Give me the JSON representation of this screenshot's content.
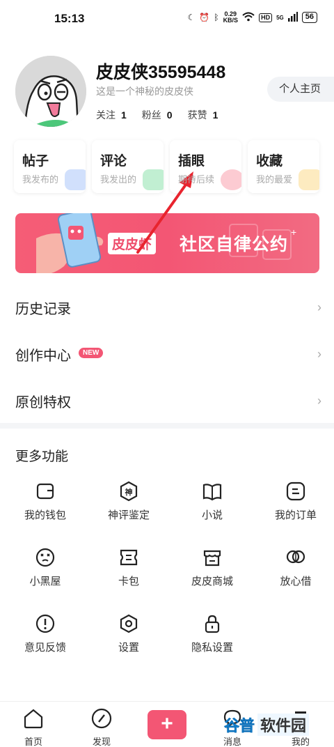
{
  "status": {
    "time": "15:13",
    "speed_value": "0.29",
    "speed_unit": "KB/S",
    "hd": "HD",
    "signal": "5G",
    "battery": "56"
  },
  "profile": {
    "username": "皮皮侠35595448",
    "bio": "这是一个神秘的皮皮侠",
    "stats": [
      {
        "label": "关注",
        "value": "1"
      },
      {
        "label": "粉丝",
        "value": "0"
      },
      {
        "label": "获赞",
        "value": "1"
      }
    ],
    "home_button": "个人主页"
  },
  "cards": [
    {
      "title": "帖子",
      "subtitle": "我发布的",
      "color": "#7aa6f5"
    },
    {
      "title": "评论",
      "subtitle": "我发出的",
      "color": "#4cd07d"
    },
    {
      "title": "插眼",
      "subtitle": "期待后续",
      "color": "#f56a7e"
    },
    {
      "title": "收藏",
      "subtitle": "我的最爱",
      "color": "#f8c54b"
    }
  ],
  "banner": {
    "logo": "皮皮虾",
    "text": "社区自律公约"
  },
  "menu": [
    {
      "label": "历史记录"
    },
    {
      "label": "创作中心",
      "badge": "NEW"
    },
    {
      "label": "原创特权"
    }
  ],
  "more": {
    "title": "更多功能",
    "items": [
      {
        "label": "我的钱包",
        "icon": "wallet-icon"
      },
      {
        "label": "神评鉴定",
        "icon": "shen-badge-icon",
        "glyph": "神"
      },
      {
        "label": "小说",
        "icon": "book-icon"
      },
      {
        "label": "我的订单",
        "icon": "order-icon"
      },
      {
        "label": "小黑屋",
        "icon": "dizzy-face-icon"
      },
      {
        "label": "卡包",
        "icon": "card-icon"
      },
      {
        "label": "皮皮商城",
        "icon": "store-icon"
      },
      {
        "label": "放心借",
        "icon": "loan-icon"
      },
      {
        "label": "意见反馈",
        "icon": "feedback-icon"
      },
      {
        "label": "设置",
        "icon": "settings-icon"
      },
      {
        "label": "隐私设置",
        "icon": "lock-icon"
      }
    ]
  },
  "nav": [
    {
      "label": "首页",
      "icon": "home-icon"
    },
    {
      "label": "发现",
      "icon": "compass-icon"
    },
    {
      "label": "+",
      "icon": "plus-icon"
    },
    {
      "label": "消息",
      "icon": "message-icon"
    },
    {
      "label": "我的",
      "icon": "profile-icon"
    }
  ],
  "watermark": {
    "part1": "谷普",
    "part2": "软件园"
  },
  "colors": {
    "accent": "#f35674",
    "text": "#222222",
    "muted": "#999999"
  }
}
